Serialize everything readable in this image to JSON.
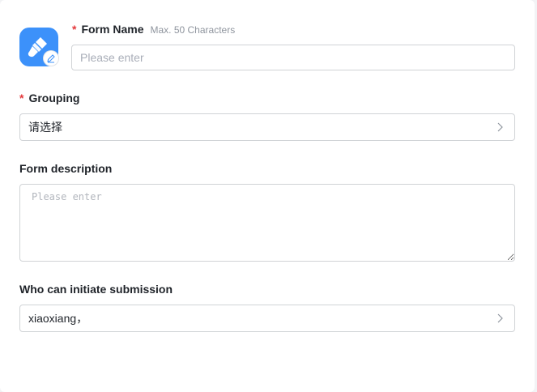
{
  "form": {
    "form_name": {
      "required_mark": "*",
      "label": "Form Name",
      "hint": "Max. 50 Characters",
      "placeholder": "Please enter",
      "value": ""
    },
    "grouping": {
      "required_mark": "*",
      "label": "Grouping",
      "value": "请选择"
    },
    "description": {
      "label": "Form description",
      "placeholder": "Please enter",
      "value": ""
    },
    "initiators": {
      "label": "Who can initiate submission",
      "value": "xiaoxiang，"
    }
  },
  "icons": {
    "app_icon": "form-brush-icon",
    "edit_badge": "edit-pencil-icon",
    "chevron": "chevron-right-icon"
  },
  "colors": {
    "accent": "#3c91fa",
    "required": "#e4393c",
    "border": "#d0d3d6",
    "placeholder": "#a9aeb8"
  }
}
